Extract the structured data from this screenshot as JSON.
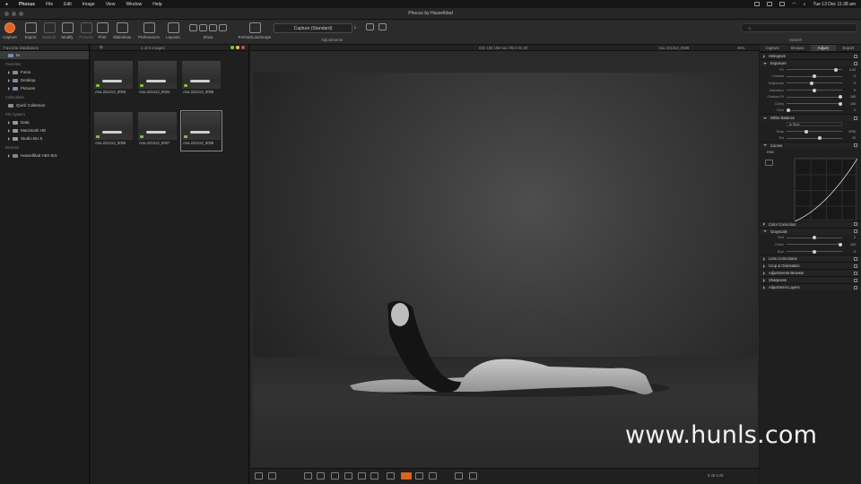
{
  "menubar": {
    "app": "Phocus",
    "items": [
      "File",
      "Edit",
      "Image",
      "View",
      "Window",
      "Help"
    ],
    "clock": "Tue 13 Dec  11:38 am"
  },
  "window": {
    "title": "Phocus by Hasselblad"
  },
  "toolbar": {
    "buttons": [
      "Capture",
      "Export",
      "Rework",
      "Modify",
      "Process",
      "Print",
      "Slideshow",
      "Preferences",
      "Layouts",
      "Show",
      "Portrait/Landscape"
    ],
    "capture_mode": "Capture (Standard)",
    "adjustments_label": "Adjustments",
    "search_label": "Search",
    "search_placeholder": "Q"
  },
  "browser": {
    "header": "Favorite Databases",
    "sections": [
      {
        "title": "Favorites",
        "items": [
          "Fotos",
          "Desktop",
          "Pictures"
        ]
      },
      {
        "title": "Collections",
        "items": [
          "Quick Collection"
        ]
      },
      {
        "title": "File System",
        "items": [
          "Data",
          "Macintosh HD",
          "Studio BU 8"
        ]
      },
      {
        "title": "Devices",
        "items": [
          "Hasselblad H6X-50c"
        ]
      }
    ]
  },
  "thumbs": {
    "count_label": "1 of 6 images",
    "items": [
      "Ana 221213_0003",
      "Ana 221213_0004",
      "Ana 221213_0005",
      "Ana 221213_0006",
      "Ana 221213_0007",
      "Ana 221213_0008"
    ]
  },
  "viewer": {
    "exif": "ISO 100  1/60 sec  f/8.0  HC 80",
    "filename": "Ana 221213_0008",
    "zoom": "45%",
    "status": "9  38  9  28"
  },
  "adjust": {
    "tabs": [
      "Capture",
      "Browse",
      "Adjust",
      "Export"
    ],
    "active_tab": "Adjust",
    "tools": [
      {
        "name": "Histogram",
        "open": false
      },
      {
        "name": "Exposure",
        "open": true,
        "sliders": [
          {
            "label": "EV",
            "value": "0.42",
            "pos": 0.92
          },
          {
            "label": "Contrast",
            "value": "0",
            "pos": 0.5
          },
          {
            "label": "Brightness",
            "value": "0",
            "pos": 0.45
          },
          {
            "label": "Saturation",
            "value": "0",
            "pos": 0.5
          },
          {
            "label": "Shadow Fill",
            "value": "100",
            "pos": 1.0
          },
          {
            "label": "Clarity",
            "value": "100",
            "pos": 1.0
          },
          {
            "label": "Glow",
            "value": "0",
            "pos": 0.0
          }
        ]
      },
      {
        "name": "White Balance",
        "open": true,
        "preset": "In Shot",
        "sliders": [
          {
            "label": "Temp",
            "value": "4700",
            "pos": 0.35
          },
          {
            "label": "Tint",
            "value": "10",
            "pos": 0.6
          }
        ]
      },
      {
        "name": "Curves",
        "open": true,
        "channel": "RGB"
      },
      {
        "name": "Color Correction",
        "open": false
      },
      {
        "name": "Grayscale",
        "open": true,
        "sliders": [
          {
            "label": "Red",
            "value": "0",
            "pos": 0.5
          },
          {
            "label": "Green",
            "value": "100",
            "pos": 1.0
          },
          {
            "label": "Blue",
            "value": "0",
            "pos": 0.5
          }
        ]
      },
      {
        "name": "Lens Corrections",
        "open": false
      },
      {
        "name": "Crop & Orientation",
        "open": false
      },
      {
        "name": "Adjustments Browser",
        "open": false
      },
      {
        "name": "Sharpness",
        "open": false
      },
      {
        "name": "Adjustment Layers",
        "open": false
      }
    ]
  },
  "watermark": "www.hunls.com",
  "colors": {
    "accent": "#e0632a",
    "panel": "#1f1f1f",
    "label_green": "#7ec43a"
  }
}
